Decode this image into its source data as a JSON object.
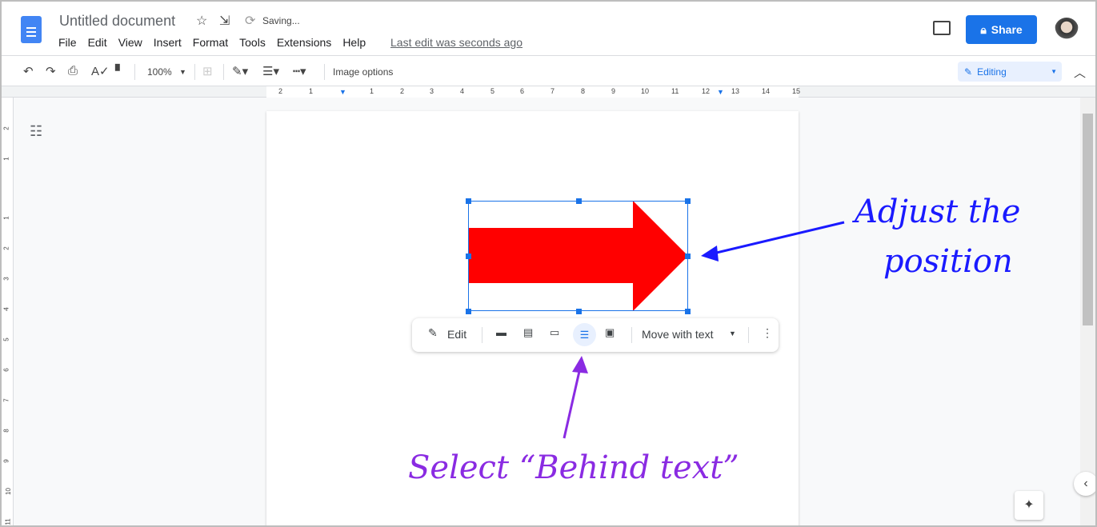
{
  "header": {
    "title": "Untitled document",
    "status": "Saving...",
    "menu": [
      "File",
      "Edit",
      "View",
      "Insert",
      "Format",
      "Tools",
      "Extensions",
      "Help"
    ],
    "last_edit": "Last edit was seconds ago",
    "share_label": "Share"
  },
  "toolbar": {
    "zoom": "100%",
    "image_options": "Image options",
    "mode": "Editing"
  },
  "ruler": {
    "h": [
      "2",
      "1",
      "1",
      "2",
      "3",
      "4",
      "5",
      "6",
      "7",
      "8",
      "9",
      "10",
      "11",
      "12",
      "13",
      "14",
      "15"
    ],
    "v": [
      "2",
      "1",
      "1",
      "2",
      "3",
      "4",
      "5",
      "6",
      "7",
      "8",
      "9",
      "10",
      "11"
    ]
  },
  "image_toolbar": {
    "edit_label": "Edit",
    "wrap_options": [
      "In line",
      "Wrap text",
      "Break text",
      "Behind text",
      "In front of text"
    ],
    "selected_wrap": "Behind text",
    "position": "Move with text"
  },
  "shape": {
    "fill": "#ff0000"
  },
  "annotations": {
    "right": [
      "Adjust the",
      "position"
    ],
    "bottom": "Select “Behind text”",
    "right_color": "#1a1aff",
    "bottom_color": "#8a2be2"
  }
}
